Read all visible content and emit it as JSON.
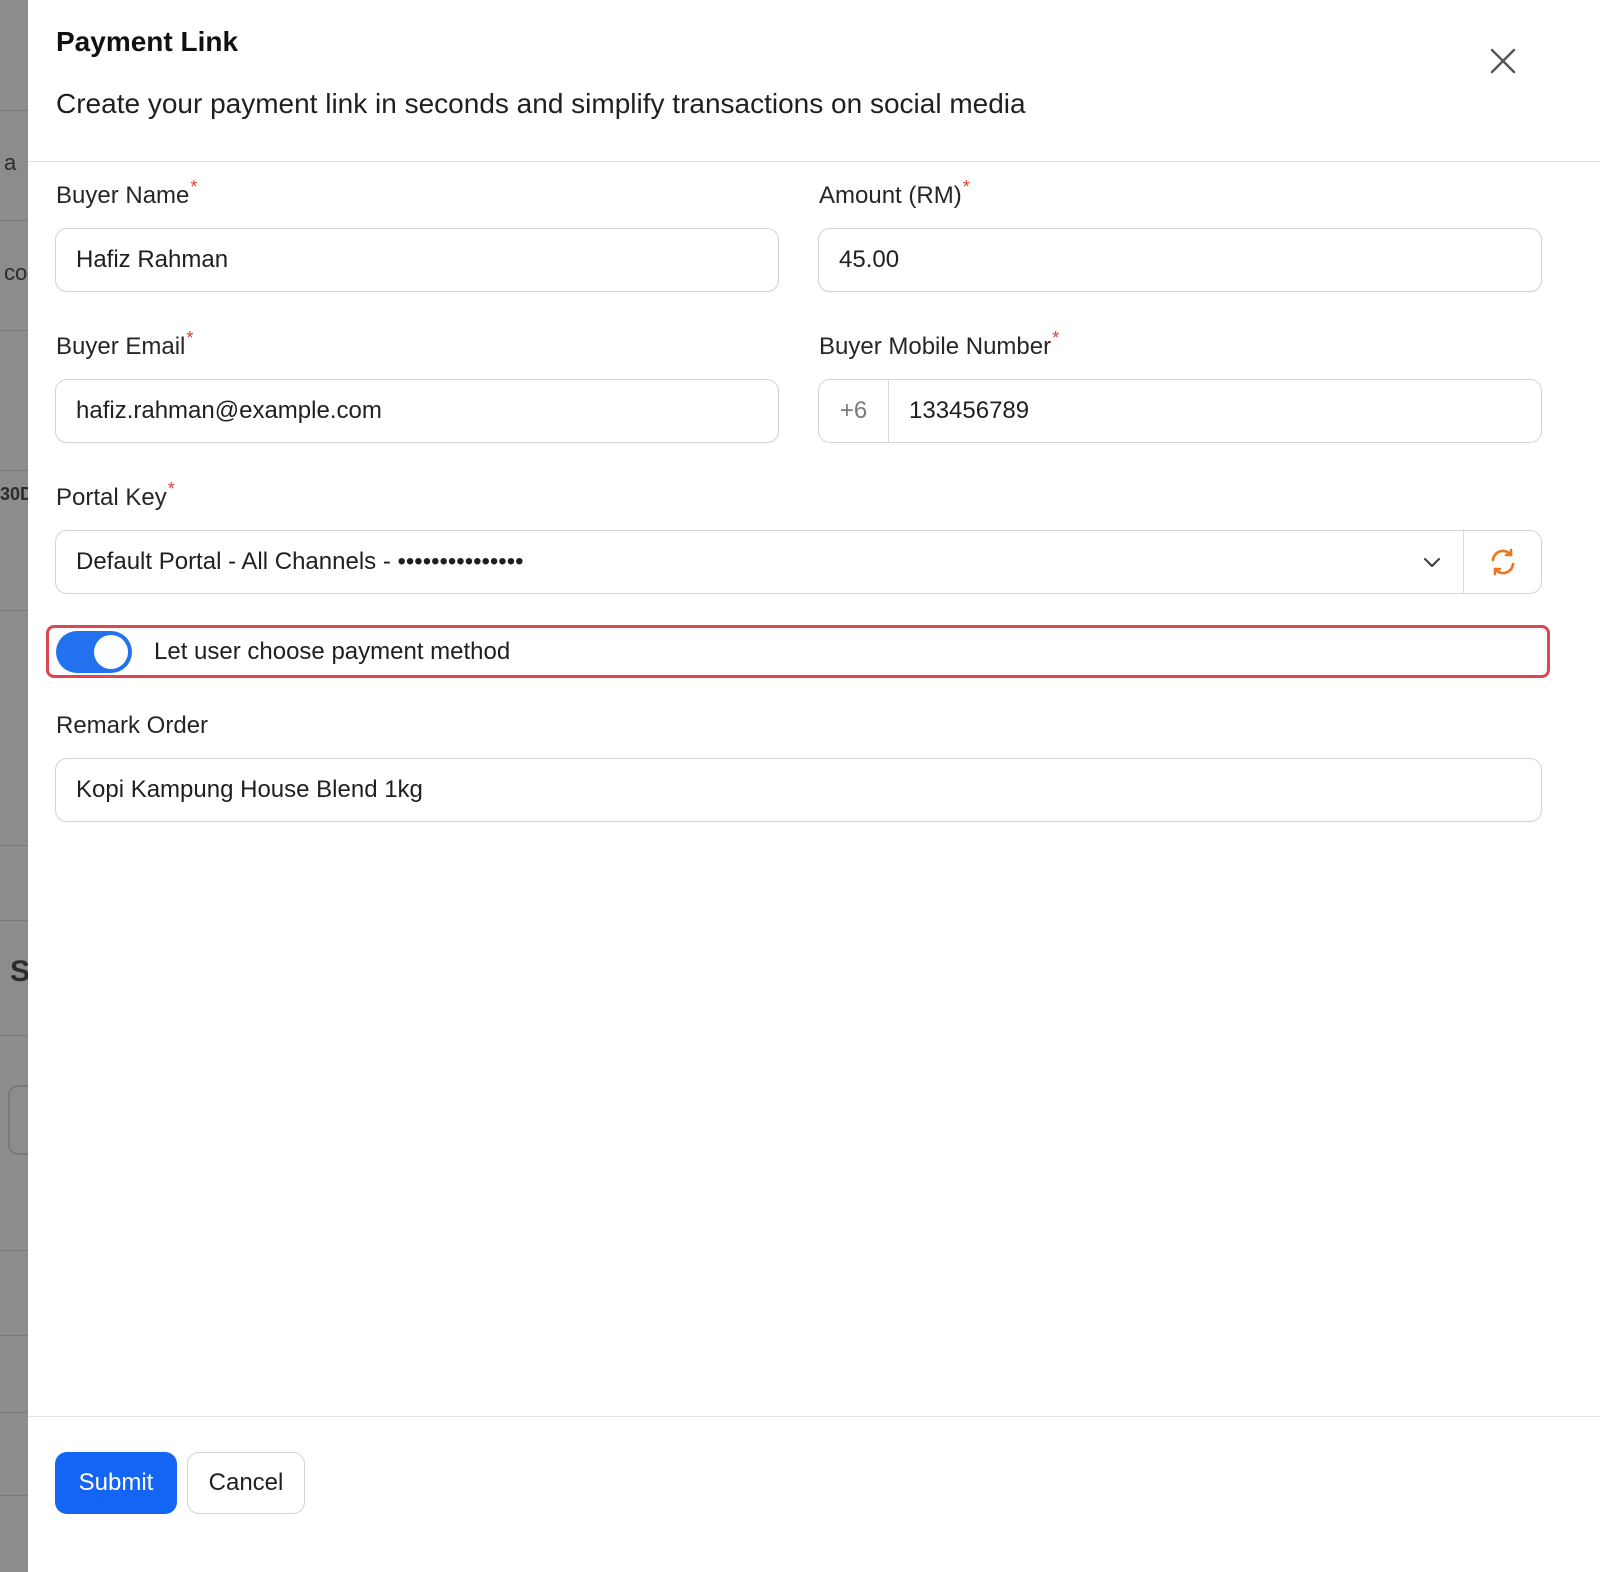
{
  "backdrop": {
    "fragments": [
      "a",
      "co",
      "30D",
      "S"
    ]
  },
  "modal": {
    "title": "Payment Link",
    "subtitle": "Create your payment link in seconds and simplify transactions on social media",
    "required_marker": "*"
  },
  "form": {
    "buyer_name": {
      "label": "Buyer Name",
      "value": "Hafiz Rahman"
    },
    "amount": {
      "label": "Amount (RM)",
      "value": "45.00"
    },
    "buyer_email": {
      "label": "Buyer Email",
      "value": "hafiz.rahman@example.com"
    },
    "buyer_mobile": {
      "label": "Buyer Mobile Number",
      "prefix": "+6",
      "value": "133456789"
    },
    "portal_key": {
      "label": "Portal Key",
      "selected": "Default Portal - All Channels - •••••••••••••••"
    },
    "choose_method": {
      "label": "Let user choose payment method",
      "enabled": true
    },
    "remark": {
      "label": "Remark Order",
      "value": "Kopi Kampung House Blend 1kg"
    }
  },
  "footer": {
    "submit_label": "Submit",
    "cancel_label": "Cancel"
  },
  "colors": {
    "primary": "#1565f5",
    "toggle_on": "#2272f0",
    "required": "#e23b3b",
    "highlight_border": "#dc4852",
    "refresh_icon": "#e87722"
  }
}
